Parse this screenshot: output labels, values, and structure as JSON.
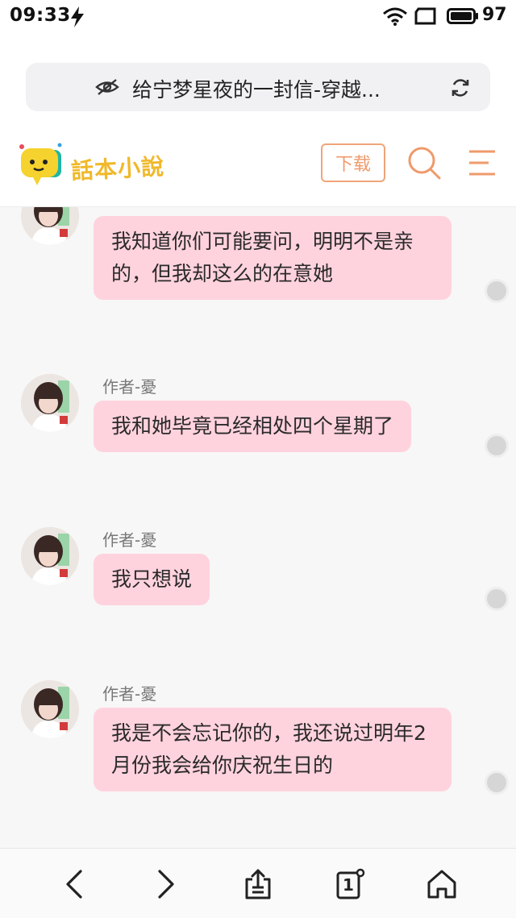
{
  "status_bar": {
    "time": "09:33",
    "battery": "97",
    "icons": [
      "charging-bolt-icon",
      "wifi-icon",
      "sim-icon",
      "battery-icon"
    ]
  },
  "url_bar": {
    "title": "给宁梦星夜的一封信-穿越...",
    "icons": [
      "eye-off-icon",
      "reload-icon"
    ]
  },
  "header": {
    "logo_text": "話本小說",
    "download_label": "下载",
    "icons": [
      "search-icon",
      "menu-icon"
    ],
    "accent_color": "#ef9a6b",
    "logo_color": "#f0b92a"
  },
  "messages": [
    {
      "author": "",
      "text": "我知道你们可能要问，明明不是亲的，但我却这么的在意她"
    },
    {
      "author": "作者-憂",
      "text": "我和她毕竟已经相处四个星期了"
    },
    {
      "author": "作者-憂",
      "text": "我只想说"
    },
    {
      "author": "作者-憂",
      "text": "我是不会忘记你的，我还说过明年2月份我会给你庆祝生日的"
    }
  ],
  "bubble_color": "#ffd3de",
  "bottom_nav": {
    "tab_count": "1",
    "icons": [
      "back-icon",
      "forward-icon",
      "share-icon",
      "tabs-icon",
      "home-icon"
    ]
  }
}
